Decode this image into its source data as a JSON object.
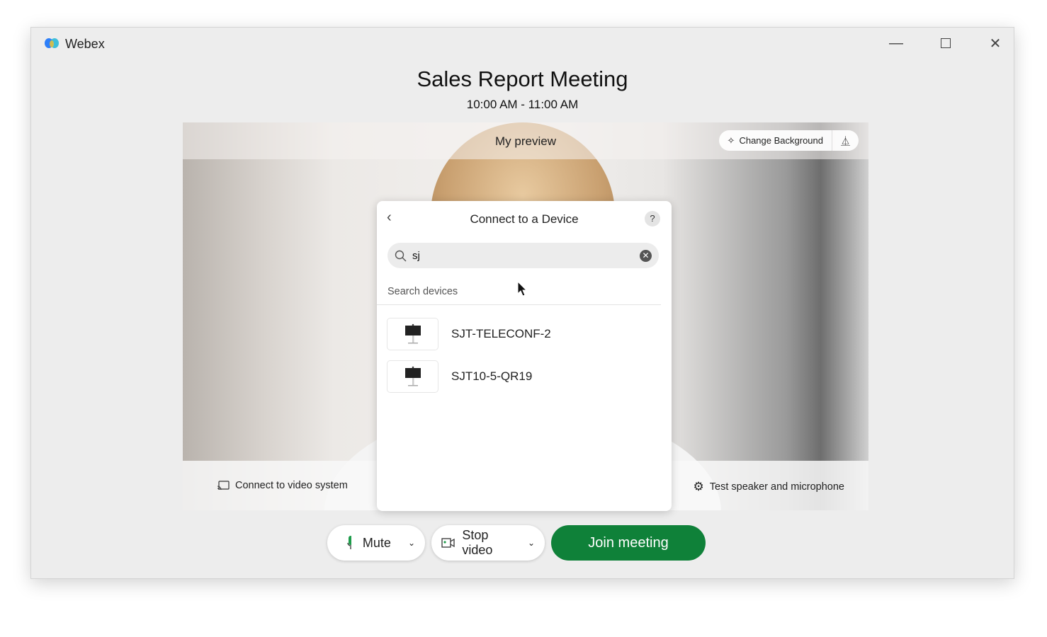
{
  "app": {
    "name": "Webex",
    "window_controls": [
      "minimize-icon",
      "maximize-icon",
      "close-icon"
    ]
  },
  "meeting": {
    "title": "Sales Report Meeting",
    "time": "10:00 AM - 11:00 AM"
  },
  "preview": {
    "label": "My preview",
    "change_background": "Change Background",
    "connect_video": "Connect to video system",
    "test_audio": "Test speaker and microphone"
  },
  "device_panel": {
    "title": "Connect to a Device",
    "help": "?",
    "search_value": "sj",
    "section_label": "Search devices",
    "devices": [
      {
        "name": "SJT-TELECONF-2"
      },
      {
        "name": "SJT10-5-QR19"
      }
    ]
  },
  "controls": {
    "mute": "Mute",
    "stop_video": "Stop video",
    "join": "Join meeting"
  },
  "colors": {
    "join": "#0f8139",
    "mic": "#1e9c4b"
  }
}
